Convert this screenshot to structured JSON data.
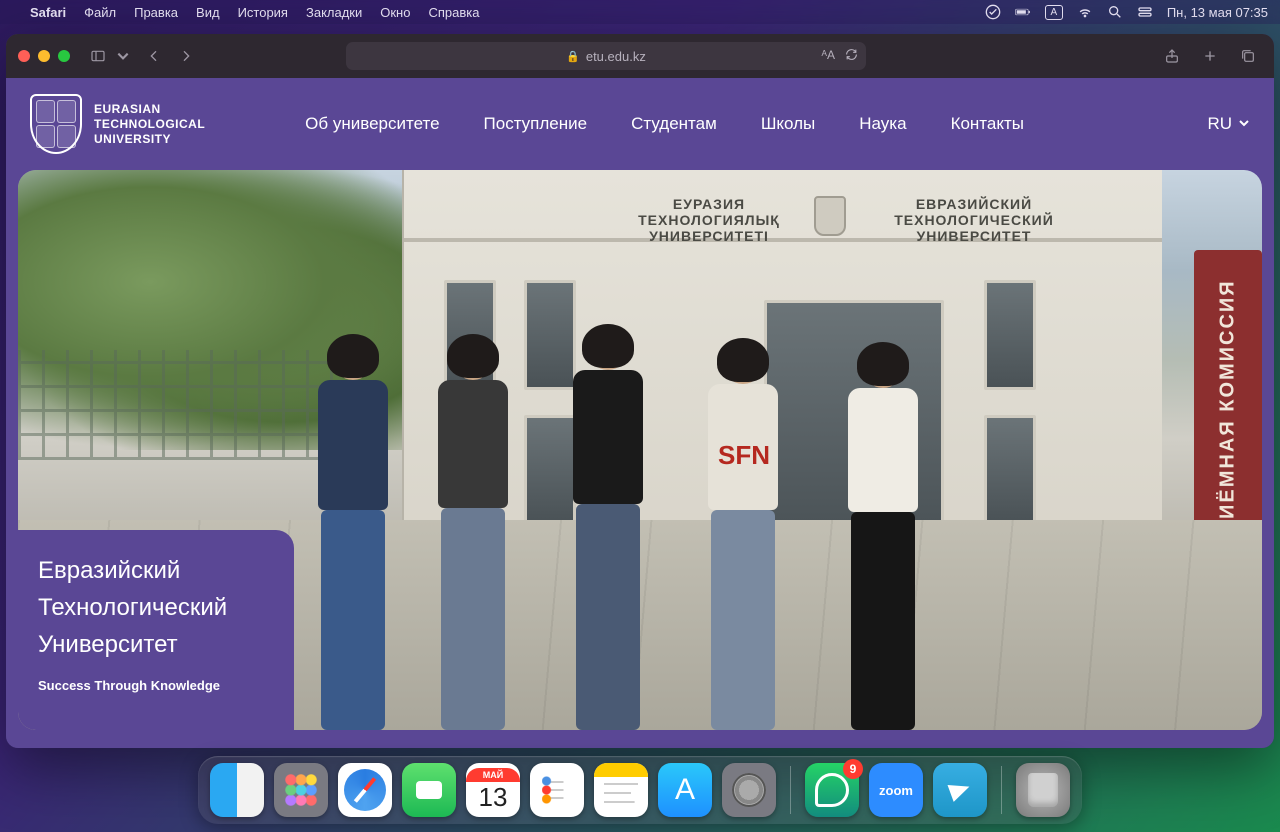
{
  "menubar": {
    "app": "Safari",
    "items": [
      "Файл",
      "Правка",
      "Вид",
      "История",
      "Закладки",
      "Окно",
      "Справка"
    ],
    "lang_indicator": "А",
    "clock": "Пн, 13 мая  07:35"
  },
  "browser": {
    "url_host": "etu.edu.kz"
  },
  "site": {
    "logo_lines": [
      "EURASIAN",
      "TECHNOLOGICAL",
      "UNIVERSITY"
    ],
    "nav": [
      "Об университете",
      "Поступление",
      "Студентам",
      "Школы",
      "Наука",
      "Контакты"
    ],
    "lang": "RU"
  },
  "hero": {
    "title_l1": "Евразийский",
    "title_l2": "Технологический",
    "title_l3": "Университет",
    "tagline": "Success Through Knowledge",
    "sign_kz": "ЕУРАЗИЯ ТЕХНОЛОГИЯЛЫҚ УНИВЕРСИТЕТІ",
    "sign_ru": "ЕВРАЗИЙСКИЙ ТЕХНОЛОГИЧЕСКИЙ УНИВЕРСИТЕТ",
    "banner_text": "ПРИЁМНАЯ КОМИССИЯ",
    "shirt_text": "SFN"
  },
  "dock": {
    "cal_month": "МАЙ",
    "cal_day": "13",
    "zoom_label": "zoom",
    "whatsapp_badge": "9"
  }
}
